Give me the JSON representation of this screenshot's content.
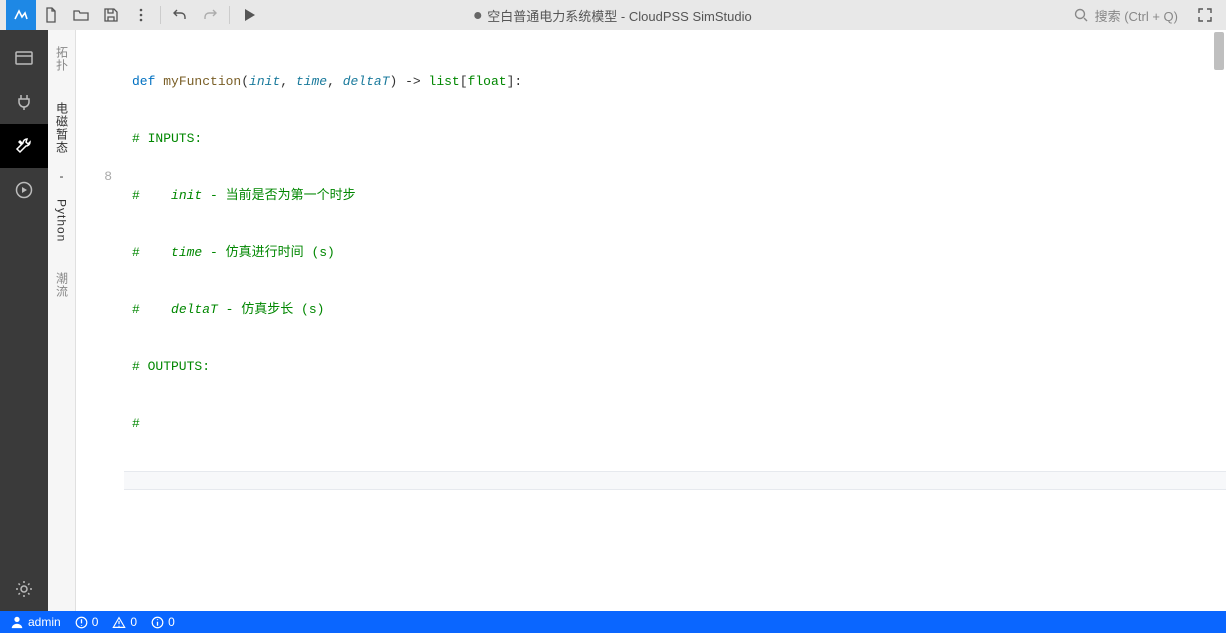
{
  "header": {
    "title_prefix": "空白普通电力系统模型",
    "title_suffix": "CloudPSS SimStudio",
    "search_placeholder": "搜索 (Ctrl + Q)"
  },
  "sidebar_tabs": {
    "topology": "拓扑",
    "emt_python": "电磁暂态 - Python",
    "powerflow": "潮流"
  },
  "editor": {
    "current_line_number": "8",
    "code": {
      "line1": {
        "kw": "def ",
        "fn": "myFunction",
        "p1": "(",
        "a1": "init",
        "c1": ", ",
        "a2": "time",
        "c2": ", ",
        "a3": "deltaT",
        "p2": ") -> ",
        "ret": "list",
        "p3": "[",
        "rt2": "float",
        "p4": "]:"
      },
      "line2": "# INPUTS:",
      "line3": {
        "h": "#    ",
        "v": "init",
        "r": " - 当前是否为第一个时步"
      },
      "line4": {
        "h": "#    ",
        "v": "time",
        "r": " - 仿真进行时间 (s)"
      },
      "line5": {
        "h": "#    ",
        "v": "deltaT",
        "r": " - 仿真步长 (s)"
      },
      "line6": "# OUTPUTS:",
      "line7": "#"
    }
  },
  "status": {
    "user": "admin",
    "errors": "0",
    "warnings": "0",
    "infos": "0"
  }
}
